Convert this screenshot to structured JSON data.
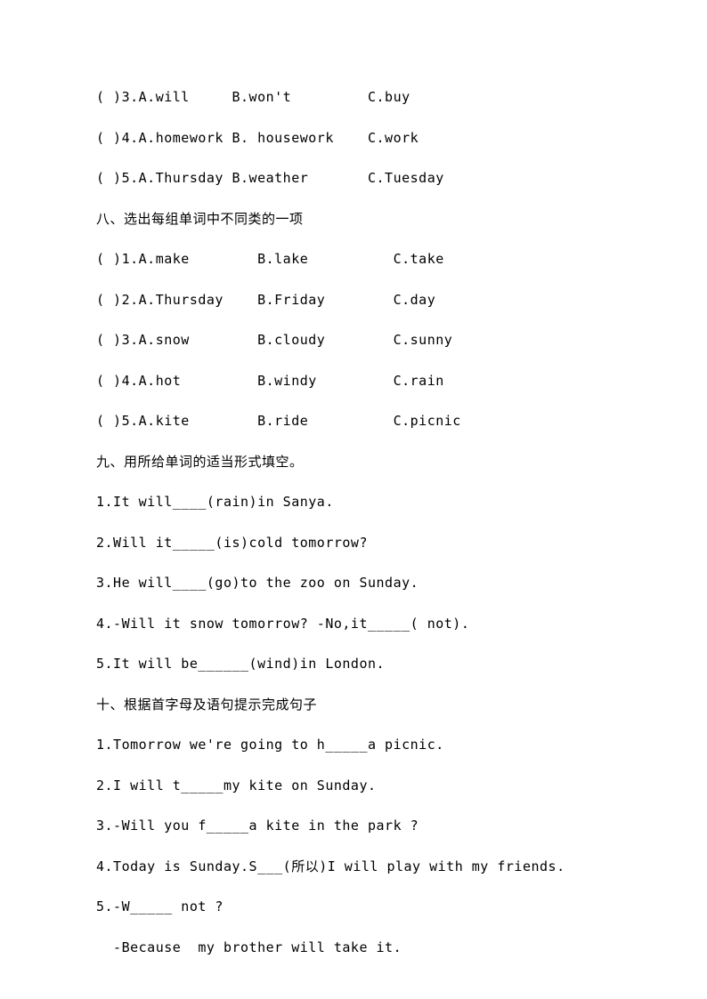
{
  "section_a": {
    "items": [
      {
        "num": "3",
        "a": "will",
        "b": "won't",
        "c": "buy"
      },
      {
        "num": "4",
        "a": "homework",
        "b": " housework",
        "c": "work"
      },
      {
        "num": "5",
        "a": "Thursday",
        "b": "weather",
        "c": "Tuesday"
      }
    ]
  },
  "section8": {
    "title": "八、选出每组单词中不同类的一项",
    "items": [
      {
        "num": "1",
        "a": "make",
        "b": "lake",
        "c": "take"
      },
      {
        "num": "2",
        "a": "Thursday",
        "b": "Friday",
        "c": "day"
      },
      {
        "num": "3",
        "a": "snow",
        "b": "cloudy",
        "c": "sunny"
      },
      {
        "num": "4",
        "a": "hot",
        "b": "windy",
        "c": "rain"
      },
      {
        "num": "5",
        "a": "kite",
        "b": "ride",
        "c": "picnic"
      }
    ]
  },
  "section9": {
    "title": "九、用所给单词的适当形式填空。",
    "items": [
      "1.It will____(rain)in Sanya.",
      "2.Will it_____(is)cold tomorrow?",
      "3.He will____(go)to the zoo on Sunday.",
      "4.-Will it snow tomorrow? -No,it_____( not).",
      "5.It will be______(wind)in London."
    ]
  },
  "section10": {
    "title": "十、根据首字母及语句提示完成句子",
    "items": [
      "1.Tomorrow we're going to h_____a picnic.",
      "2.I will t_____my kite on Sunday.",
      "3.-Will you f_____a kite in the park ?",
      "4.Today is Sunday.S___(所以)I will play with my friends.",
      "5.-W_____ not ?",
      "  -Because  my brother will take it."
    ]
  }
}
